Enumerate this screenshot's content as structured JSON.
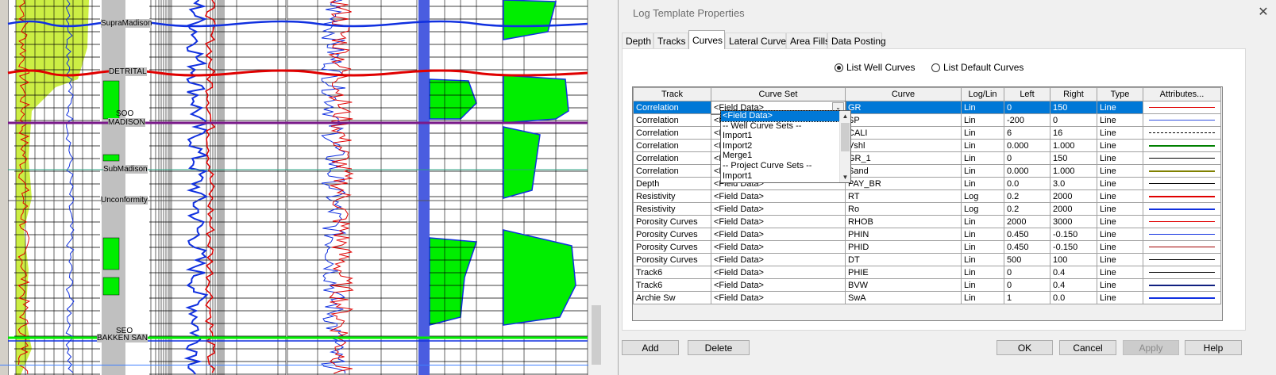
{
  "log": {
    "formations": [
      "SupraMadison",
      "DETRITAL",
      "MADISON",
      "SubMadison",
      "Unconformity",
      "BAKKEN SAN"
    ],
    "overlay_marks": [
      "SOO",
      "SEO"
    ],
    "colors": {
      "lime": "#ccee44",
      "green": "#00ee00",
      "blue_fill": "#4a5de0",
      "red": "#e00000",
      "blue": "#1030e0",
      "purple": "#7a1a8a"
    }
  },
  "dialog": {
    "title": "Log Template Properties",
    "close_glyph": "✕",
    "tabs": [
      "Depth",
      "Tracks",
      "Curves",
      "Lateral Curves",
      "Area Fills",
      "Data Posting"
    ],
    "active_tab": "Curves",
    "radio_well": "List Well Curves",
    "radio_default": "List Default Curves",
    "selected_radio": "List Well Curves",
    "columns": [
      "Track",
      "Curve Set",
      "Curve",
      "Log/Lin",
      "Left",
      "Right",
      "Type",
      "Attributes..."
    ],
    "rows": [
      {
        "track": "Correlation",
        "curve_set": "<Field Data>",
        "curve": "GR",
        "scale": "Lin",
        "left": "0",
        "right": "150",
        "type": "Line",
        "line_color": "#e00000",
        "line_style": "solid",
        "line_width": 1
      },
      {
        "track": "Correlation",
        "curve_set": "<Field Data>",
        "curve": "SP",
        "scale": "Lin",
        "left": "-200",
        "right": "0",
        "type": "Line",
        "line_color": "#3050e0",
        "line_style": "solid",
        "line_width": 1
      },
      {
        "track": "Correlation",
        "curve_set": "<Field Data>",
        "curve": "CALI",
        "scale": "Lin",
        "left": "6",
        "right": "16",
        "type": "Line",
        "line_color": "#000000",
        "line_style": "dashed",
        "line_width": 1
      },
      {
        "track": "Correlation",
        "curve_set": "<Field Data>",
        "curve": "Vshl",
        "scale": "Lin",
        "left": "0.000",
        "right": "1.000",
        "type": "Line",
        "line_color": "#008000",
        "line_style": "solid",
        "line_width": 2
      },
      {
        "track": "Correlation",
        "curve_set": "<Field Data>",
        "curve": "GR_1",
        "scale": "Lin",
        "left": "0",
        "right": "150",
        "type": "Line",
        "line_color": "#000000",
        "line_style": "solid",
        "line_width": 1
      },
      {
        "track": "Correlation",
        "curve_set": "<Field Data>",
        "curve": "Sand",
        "scale": "Lin",
        "left": "0.000",
        "right": "1.000",
        "type": "Line",
        "line_color": "#808000",
        "line_style": "solid",
        "line_width": 2
      },
      {
        "track": "Depth",
        "curve_set": "<Field Data>",
        "curve": "PAY_BR",
        "scale": "Lin",
        "left": "0.0",
        "right": "3.0",
        "type": "Line",
        "line_color": "#000000",
        "line_style": "solid",
        "line_width": 1
      },
      {
        "track": "Resistivity",
        "curve_set": "<Field Data>",
        "curve": "RT",
        "scale": "Log",
        "left": "0.2",
        "right": "2000",
        "type": "Line",
        "line_color": "#e00000",
        "line_style": "solid",
        "line_width": 2
      },
      {
        "track": "Resistivity",
        "curve_set": "<Field Data>",
        "curve": "Ro",
        "scale": "Log",
        "left": "0.2",
        "right": "2000",
        "type": "Line",
        "line_color": "#1030e0",
        "line_style": "solid",
        "line_width": 2
      },
      {
        "track": "Porosity Curves",
        "curve_set": "<Field Data>",
        "curve": "RHOB",
        "scale": "Lin",
        "left": "2000",
        "right": "3000",
        "type": "Line",
        "line_color": "#e00000",
        "line_style": "solid",
        "line_width": 1
      },
      {
        "track": "Porosity Curves",
        "curve_set": "<Field Data>",
        "curve": "PHIN",
        "scale": "Lin",
        "left": "0.450",
        "right": "-0.150",
        "type": "Line",
        "line_color": "#1030e0",
        "line_style": "solid",
        "line_width": 1
      },
      {
        "track": "Porosity Curves",
        "curve_set": "<Field Data>",
        "curve": "PHID",
        "scale": "Lin",
        "left": "0.450",
        "right": "-0.150",
        "type": "Line",
        "line_color": "#a00000",
        "line_style": "solid",
        "line_width": 1
      },
      {
        "track": "Porosity Curves",
        "curve_set": "<Field Data>",
        "curve": "DT",
        "scale": "Lin",
        "left": "500",
        "right": "100",
        "type": "Line",
        "line_color": "#000000",
        "line_style": "solid",
        "line_width": 1
      },
      {
        "track": "Track6",
        "curve_set": "<Field Data>",
        "curve": "PHIE",
        "scale": "Lin",
        "left": "0",
        "right": "0.4",
        "type": "Line",
        "line_color": "#000000",
        "line_style": "solid",
        "line_width": 1
      },
      {
        "track": "Track6",
        "curve_set": "<Field Data>",
        "curve": "BVW",
        "scale": "Lin",
        "left": "0",
        "right": "0.4",
        "type": "Line",
        "line_color": "#102080",
        "line_style": "solid",
        "line_width": 2
      },
      {
        "track": "Archie Sw",
        "curve_set": "<Field Data>",
        "curve": "SwA",
        "scale": "Lin",
        "left": "1",
        "right": "0.0",
        "type": "Line",
        "line_color": "#1030e0",
        "line_style": "solid",
        "line_width": 2
      }
    ],
    "selected_row": 0,
    "dropdown_items": [
      "<Field Data>",
      "-- Well Curve Sets --",
      "Import1",
      "Import2",
      "Merge1",
      "-- Project Curve Sets --",
      "Import1"
    ],
    "buttons": {
      "add": "Add",
      "delete": "Delete",
      "ok": "OK",
      "cancel": "Cancel",
      "apply": "Apply",
      "help": "Help"
    }
  }
}
